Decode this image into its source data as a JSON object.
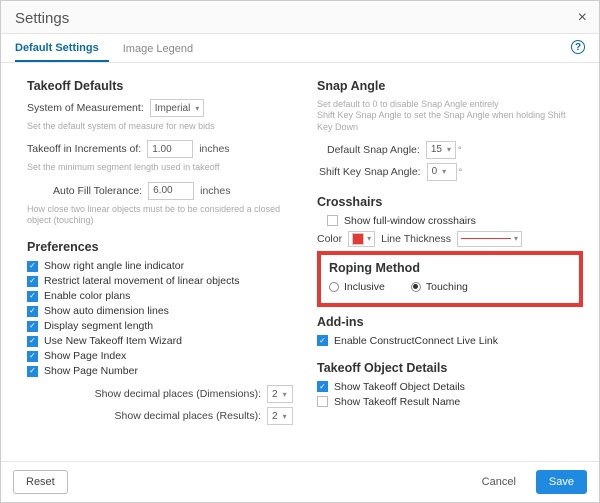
{
  "dialog": {
    "title": "Settings"
  },
  "tabs": {
    "default": "Default Settings",
    "legend": "Image Legend"
  },
  "takeoff": {
    "heading": "Takeoff Defaults",
    "som_label": "System of Measurement:",
    "som_value": "Imperial",
    "som_hint": "Set the default system of measure for new bids",
    "inc_label": "Takeoff in Increments of:",
    "inc_value": "1.00",
    "inc_unit": "inches",
    "inc_hint": "Set the minimum segment length used in takeoff",
    "aft_label": "Auto Fill Tolerance:",
    "aft_value": "6.00",
    "aft_unit": "inches",
    "aft_hint": "How close two linear objects must be to be considered a closed object (touching)"
  },
  "prefs": {
    "heading": "Preferences",
    "items": [
      "Show right angle line indicator",
      "Restrict lateral movement of linear objects",
      "Enable color plans",
      "Show auto dimension lines",
      "Display segment length",
      "Use New Takeoff Item Wizard",
      "Show Page Index",
      "Show Page Number"
    ],
    "dim_label": "Show decimal places (Dimensions):",
    "dim_value": "2",
    "res_label": "Show decimal places (Results):",
    "res_value": "2"
  },
  "snap": {
    "heading": "Snap Angle",
    "hint": "Set default to 0 to disable Snap Angle entirely\nShift Key Snap Angle to set the Snap Angle when holding Shift Key Down",
    "def_label": "Default Snap Angle:",
    "def_value": "15",
    "shift_label": "Shift Key Snap Angle:",
    "shift_value": "0"
  },
  "cross": {
    "heading": "Crosshairs",
    "show": "Show full-window crosshairs",
    "color_label": "Color",
    "thick_label": "Line Thickness"
  },
  "roping": {
    "heading": "Roping Method",
    "inclusive": "Inclusive",
    "touching": "Touching"
  },
  "addins": {
    "heading": "Add-ins",
    "cc": "Enable ConstructConnect Live Link"
  },
  "tod": {
    "heading": "Takeoff Object Details",
    "a": "Show Takeoff Object Details",
    "b": "Show Takeoff Result Name"
  },
  "footer": {
    "reset": "Reset",
    "cancel": "Cancel",
    "save": "Save"
  }
}
